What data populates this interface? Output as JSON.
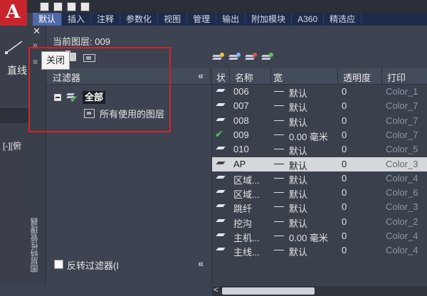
{
  "app": {
    "ribbon_tabs": [
      "默认",
      "插入",
      "注释",
      "参数化",
      "视图",
      "管理",
      "输出",
      "附加模块",
      "A360",
      "精选应"
    ],
    "active_tab_index": 0,
    "left_tool_label": "直线",
    "viewport_label": "[-][俯"
  },
  "palette": {
    "side_close": "✕",
    "side_min": "»",
    "side_menu": "≡",
    "vertical_title": "图层特性管理器",
    "current_layer": "当前图层: 009",
    "tooltip": "关闭",
    "filters_header": "过滤器",
    "collapse": "«",
    "tree": {
      "all": "全部",
      "used": "所有使用的图层"
    },
    "invert_filter": "反转过滤器(I",
    "columns": {
      "status": "状",
      "name": "名称",
      "lineweight": "宽",
      "transparency": "透明度",
      "print": "打印"
    },
    "layers": [
      {
        "name": "006",
        "lineweight": "默认",
        "transparency": "0",
        "print": "Color_1",
        "current": false
      },
      {
        "name": "007",
        "lineweight": "默认",
        "transparency": "0",
        "print": "Color_7",
        "current": false
      },
      {
        "name": "008",
        "lineweight": "默认",
        "transparency": "0",
        "print": "Color_7",
        "current": false
      },
      {
        "name": "009",
        "lineweight": "0.00 毫米",
        "transparency": "0",
        "print": "Color_7",
        "current": true
      },
      {
        "name": "010",
        "lineweight": "默认",
        "transparency": "0",
        "print": "Color_5",
        "current": false
      },
      {
        "name": "AP",
        "lineweight": "默认",
        "transparency": "0",
        "print": "Color_3",
        "current": false,
        "selected": true
      },
      {
        "name": "区域...",
        "lineweight": "默认",
        "transparency": "0",
        "print": "Color_4",
        "current": false
      },
      {
        "name": "区域...",
        "lineweight": "默认",
        "transparency": "0",
        "print": "Color_6",
        "current": false
      },
      {
        "name": "跳纤",
        "lineweight": "默认",
        "transparency": "0",
        "print": "Color_3",
        "current": false
      },
      {
        "name": "挖沟",
        "lineweight": "默认",
        "transparency": "0",
        "print": "Color_2",
        "current": false
      },
      {
        "name": "主机...",
        "lineweight": "0.00 毫米",
        "transparency": "0",
        "print": "Color_4",
        "current": false
      },
      {
        "name": "主线...",
        "lineweight": "默认",
        "transparency": "0",
        "print": "Color_4",
        "current": false
      }
    ],
    "scroll_left": "<"
  }
}
